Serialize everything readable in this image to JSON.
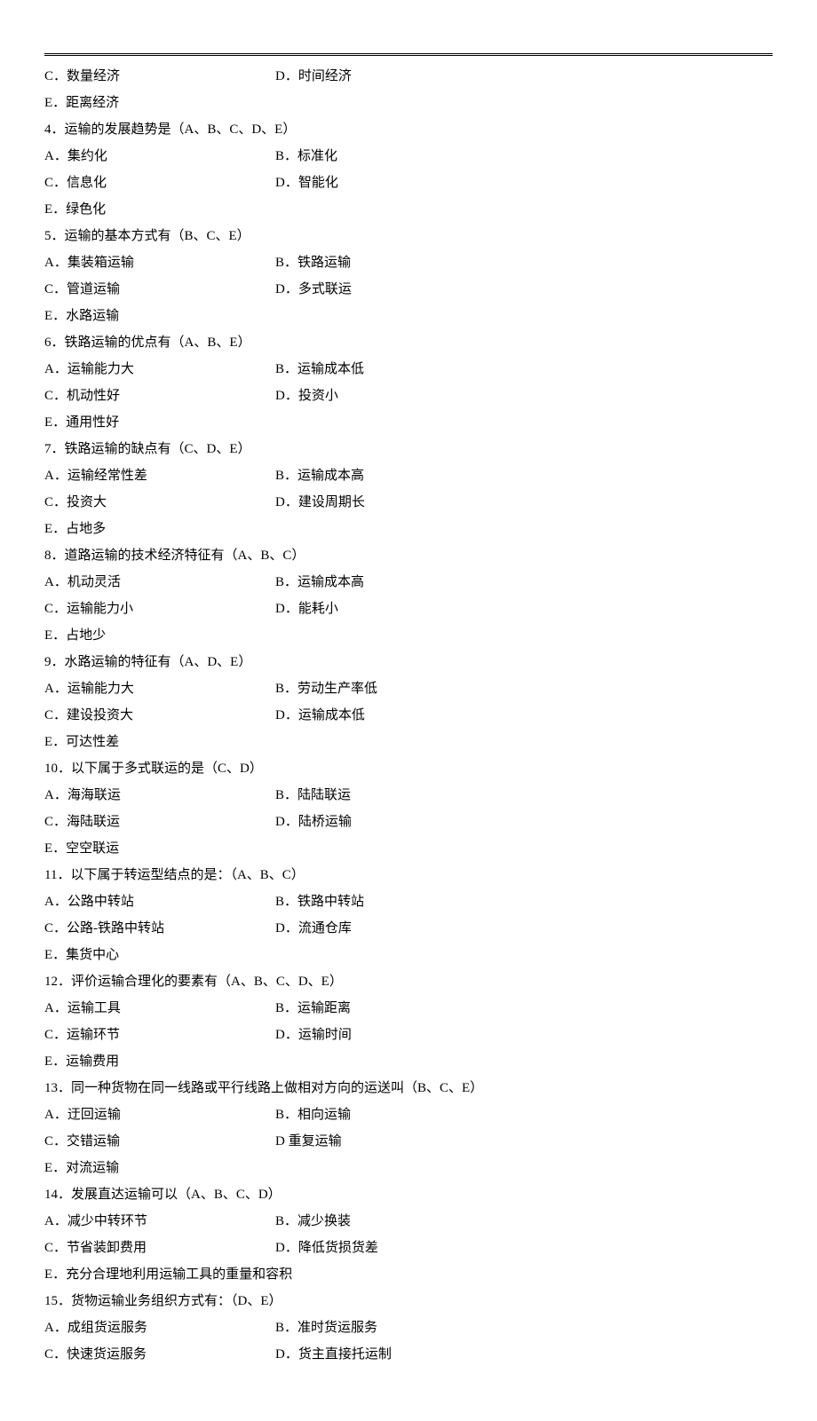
{
  "top_options": {
    "c": "C．数量经济",
    "d": "D．时间经济",
    "e": "E．距离经济"
  },
  "questions": [
    {
      "title": "4．运输的发展趋势是（A、B、C、D、E）",
      "a": "A．集约化",
      "b": "B．标准化",
      "c": "C．信息化",
      "d": "D．智能化",
      "e": "E．绿色化"
    },
    {
      "title": "5．运输的基本方式有（B、C、E）",
      "a": "A．集装箱运输",
      "b": "B．铁路运输",
      "c": "C．管道运输",
      "d": "D．多式联运",
      "e": "E．水路运输"
    },
    {
      "title": "6．铁路运输的优点有（A、B、E）",
      "a": "A．运输能力大",
      "b": "B．运输成本低",
      "c": "C．机动性好",
      "d": "D．投资小",
      "e": "E．通用性好"
    },
    {
      "title": "7．铁路运输的缺点有（C、D、E）",
      "a": "A．运输经常性差",
      "b": "B．运输成本高",
      "c": "C．投资大",
      "d": "D．建设周期长",
      "e": "E．占地多"
    },
    {
      "title": "8．道路运输的技术经济特征有（A、B、C）",
      "a": "A．机动灵活",
      "b": "B．运输成本高",
      "c": "C．运输能力小",
      "d": "D．能耗小",
      "e": "E．占地少"
    },
    {
      "title": "9．水路运输的特征有（A、D、E）",
      "a": "A．运输能力大",
      "b": "B．劳动生产率低",
      "c": "C．建设投资大",
      "d": "D．运输成本低",
      "e": "E．可达性差"
    },
    {
      "title": "10．以下属于多式联运的是（C、D）",
      "a": "A．海海联运",
      "b": "B．陆陆联运",
      "c": "C．海陆联运",
      "d": "D．陆桥运输",
      "e": "E．空空联运"
    },
    {
      "title": "11．以下属于转运型结点的是：（A、B、C）",
      "a": "A．公路中转站",
      "b": "B．铁路中转站",
      "c": "C．公路-铁路中转站",
      "d": "D．流通仓库",
      "e": "E．集货中心"
    },
    {
      "title": "12．评价运输合理化的要素有（A、B、C、D、E）",
      "a": "A．运输工具",
      "b": "B．运输距离",
      "c": "C．运输环节",
      "d": "D．运输时间",
      "e": "E．运输费用"
    },
    {
      "title": "13．同一种货物在同一线路或平行线路上做相对方向的运送叫（B、C、E）",
      "a": "A．迂回运输",
      "b": "B．相向运输",
      "c": "C．交错运输",
      "d": "D 重复运输",
      "e": "E．对流运输"
    },
    {
      "title": "14．发展直达运输可以（A、B、C、D）",
      "a": "A．减少中转环节",
      "b": "B．减少换装",
      "c": "C．节省装卸费用",
      "d": "D．降低货损货差",
      "e": "E．充分合理地利用运输工具的重量和容积"
    },
    {
      "title": "15．货物运输业务组织方式有：（D、E）",
      "a": "A．成组货运服务",
      "b": "B．准时货运服务",
      "c": "C．快速货运服务",
      "d": "D．货主直接托运制",
      "e": ""
    }
  ]
}
